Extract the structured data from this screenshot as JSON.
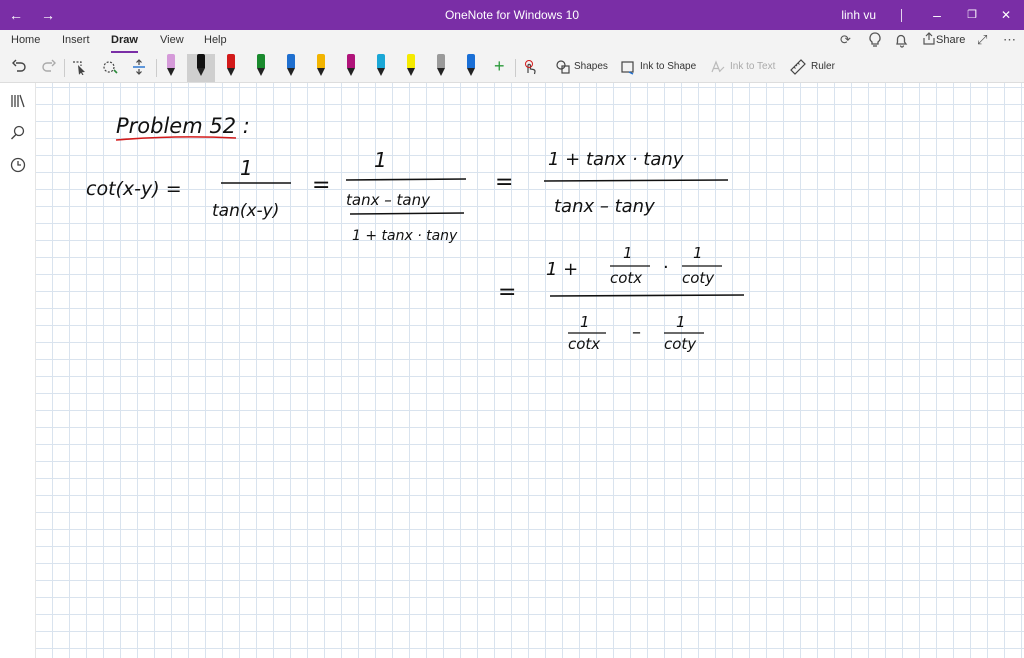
{
  "titlebar": {
    "title": "OneNote for Windows 10",
    "user": "linh vu",
    "back_glyph": "←",
    "forward_glyph": "→",
    "minimize_glyph": "–",
    "restore_glyph": "❐",
    "close_glyph": "✕"
  },
  "menu": {
    "tabs": [
      "Home",
      "Insert",
      "Draw",
      "View",
      "Help"
    ],
    "active": "Draw",
    "share_label": "Share",
    "more_glyph": "⋯"
  },
  "toolbar": {
    "shapes_label": "Shapes",
    "ink_to_shape_label": "Ink to Shape",
    "ink_to_text_label": "Ink to Text",
    "ruler_label": "Ruler",
    "add_pen_glyph": "+",
    "pens": [
      {
        "color": "#d59ad9"
      },
      {
        "color": "#111111"
      },
      {
        "color": "#d21a1a"
      },
      {
        "color": "#1a8a2e"
      },
      {
        "color": "#1f6fcf"
      },
      {
        "color": "#f2b400"
      },
      {
        "color": "#b0147a"
      },
      {
        "color": "#1aa7d6"
      },
      {
        "color": "#f5ea00"
      },
      {
        "color": "#9a9a9a"
      },
      {
        "color": "#1a6fd6"
      }
    ]
  },
  "note": {
    "heading": "Problem 52 :",
    "heading_color": "#d31a1a",
    "line1": {
      "lhs": "cot(x-y) =",
      "frac1_num": "1",
      "frac1_den": "tan(x-y)",
      "eq1": "=",
      "frac2_num": "1",
      "frac2_inner_num": "tanx – tany",
      "frac2_inner_den": "1 + tanx · tany",
      "eq2": "=",
      "frac3_num": "1 + tanx · tany",
      "frac3_den": "tanx – tany"
    },
    "line2": {
      "eq": "=",
      "num_prefix": "1 +",
      "f1_num": "1",
      "f1_den": "cotx",
      "dot": "·",
      "f2_num": "1",
      "f2_den": "coty",
      "den_f1_num": "1",
      "den_f1_den": "cotx",
      "minus": "–",
      "den_f2_num": "1",
      "den_f2_den": "coty"
    }
  }
}
